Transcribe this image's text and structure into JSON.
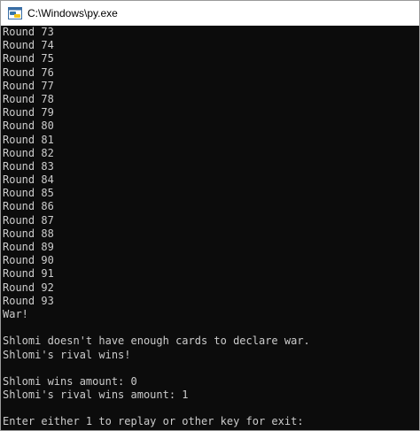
{
  "window": {
    "title": "C:\\Windows\\py.exe",
    "icon": "python-console-icon"
  },
  "console": {
    "lines": [
      "Round 73",
      "Round 74",
      "Round 75",
      "Round 76",
      "Round 77",
      "Round 78",
      "Round 79",
      "Round 80",
      "Round 81",
      "Round 82",
      "Round 83",
      "Round 84",
      "Round 85",
      "Round 86",
      "Round 87",
      "Round 88",
      "Round 89",
      "Round 90",
      "Round 91",
      "Round 92",
      "Round 93",
      "War!",
      "",
      "Shlomi doesn't have enough cards to declare war.",
      "Shlomi's rival wins!",
      "",
      "Shlomi wins amount: 0",
      "Shlomi's rival wins amount: 1",
      "",
      "Enter either 1 to replay or other key for exit:"
    ]
  },
  "colors": {
    "console_background": "#0c0c0c",
    "console_text": "#cccccc",
    "titlebar_background": "#ffffff"
  }
}
